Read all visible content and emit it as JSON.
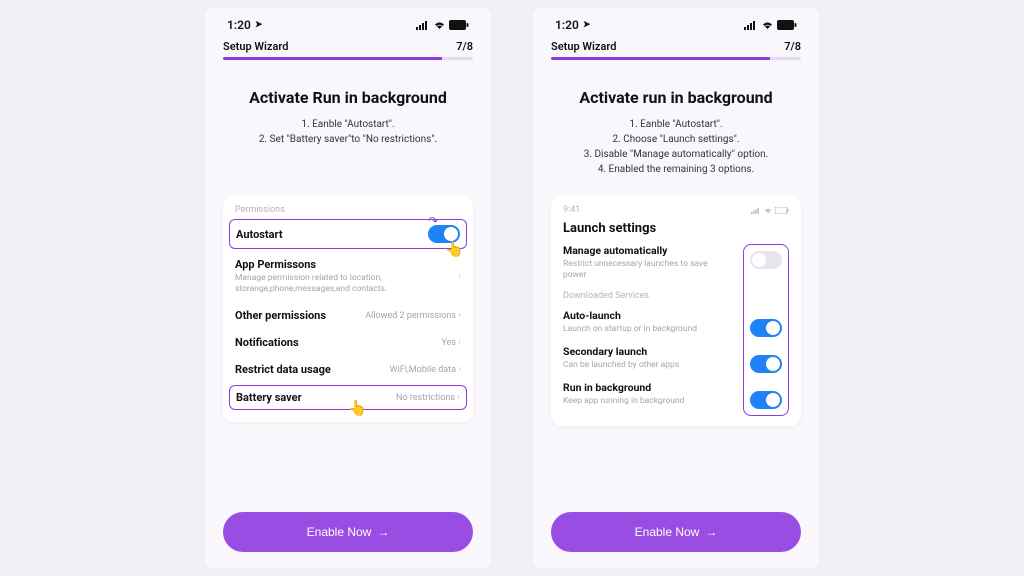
{
  "statusbar": {
    "time": "1:20",
    "location_icon": "➤"
  },
  "wizard": {
    "label": "Setup Wizard",
    "step": "7/8",
    "percent": 87.5
  },
  "screen1": {
    "heading": "Activate Run in background",
    "instr1": "1. Eanble \"Autostart\".",
    "instr2": "2. Set \"Battery saver\"to \"No restrictions\".",
    "card": {
      "permissions_label": "Permissions",
      "autostart": "Autostart",
      "app_permissions": "App Permissons",
      "app_permissions_sub": "Manage permission related to location, storange,phone,messages,and contacts.",
      "other_permissions": "Other permissions",
      "other_permissions_val": "Allowed 2 permissions",
      "notifications": "Notifications",
      "notifications_val": "Yes",
      "restrict_data": "Restrict data usage",
      "restrict_data_val": "WiFi,Mobile data",
      "battery_saver": "Battery saver",
      "battery_saver_val": "No restrictions"
    }
  },
  "screen2": {
    "heading": "Activate run in background",
    "instr1": "1. Eanble \"Autostart\".",
    "instr2": "2. Choose \"Launch settings\".",
    "instr3": "3. Disable \"Manage automatically\" option.",
    "instr4": "4. Enabled the remaining 3 options.",
    "card": {
      "time": "9:41",
      "title": "Launch settings",
      "manage_auto": "Manage automatically",
      "manage_auto_sub": "Restrict unnecessary launches to save power",
      "downloaded_services": "Downloaded Services",
      "auto_launch": "Auto-launch",
      "auto_launch_sub": "Launch on startup or in background",
      "secondary_launch": "Secondary launch",
      "secondary_launch_sub": "Can be launched by other apps",
      "run_bg": "Run in background",
      "run_bg_sub": "Keep app running in background"
    }
  },
  "cta": "Enable Now"
}
